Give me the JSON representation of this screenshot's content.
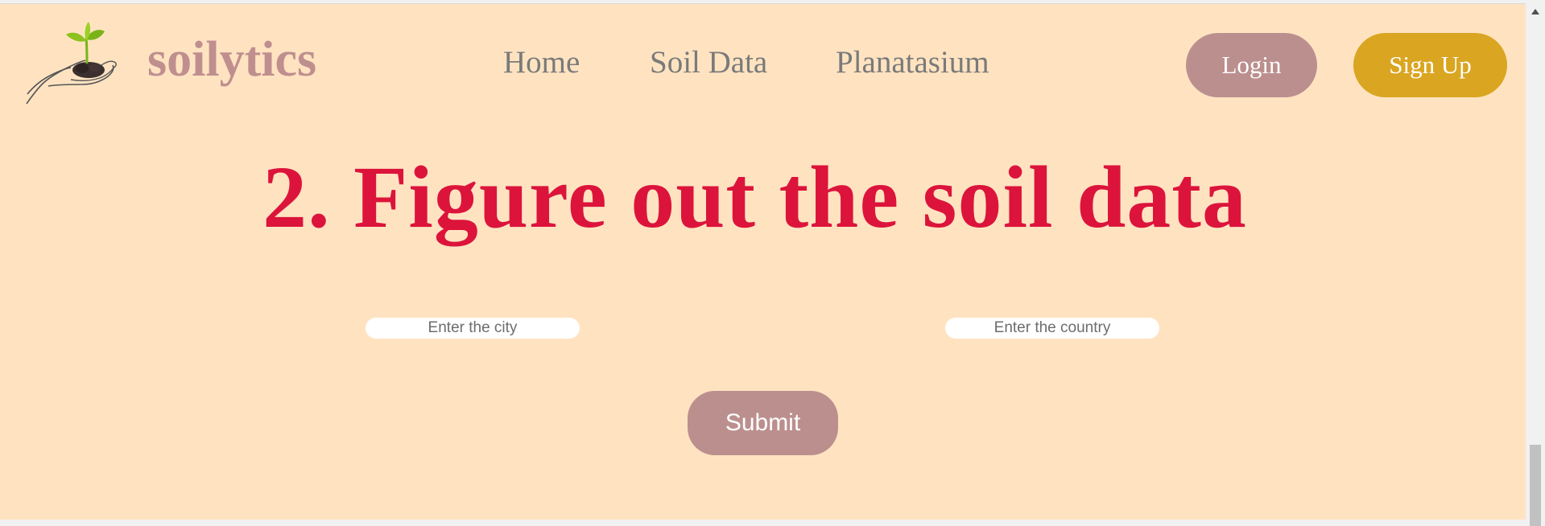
{
  "header": {
    "brand": "soilytics",
    "nav": {
      "home": "Home",
      "soil_data": "Soil Data",
      "planatasium": "Planatasium"
    },
    "login_label": "Login",
    "signup_label": "Sign Up"
  },
  "main": {
    "heading": "2. Figure out the soil data",
    "city_placeholder": "Enter the city",
    "country_placeholder": "Enter the country",
    "submit_label": "Submit"
  },
  "icons": {
    "logo": "hand-holding-seedling-icon",
    "scroll_up": "triangle-up-icon"
  },
  "colors": {
    "background": "#ffe3c1",
    "brand": "#bf8f8f",
    "heading": "#dc143c",
    "login_button": "#bc8f8f",
    "signup_button": "#daa521",
    "nav_text": "#7a7a7a"
  }
}
